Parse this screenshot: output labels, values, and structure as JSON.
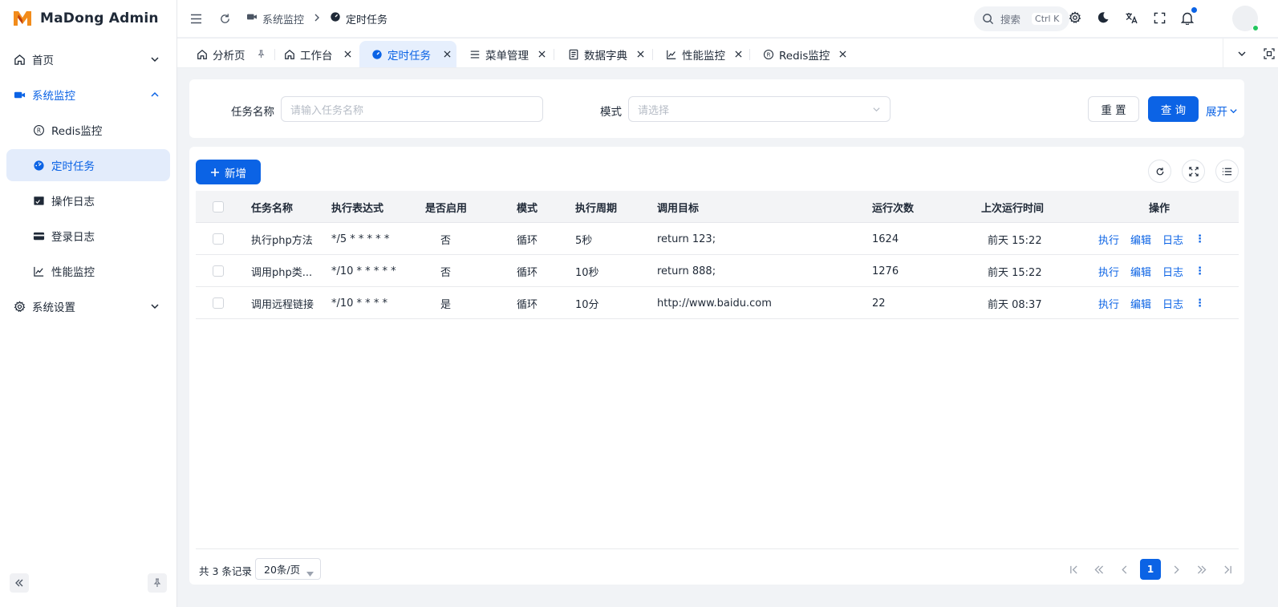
{
  "app": {
    "title": "MaDong Admin",
    "logo_letter": "M"
  },
  "sidebar": {
    "items": [
      {
        "label": "首页",
        "icon": "home-icon"
      },
      {
        "label": "系统监控",
        "icon": "monitor-icon"
      },
      {
        "label": "Redis监控",
        "icon": "redis-icon"
      },
      {
        "label": "定时任务",
        "icon": "dashboard-icon"
      },
      {
        "label": "操作日志",
        "icon": "log-icon"
      },
      {
        "label": "登录日志",
        "icon": "card-icon"
      },
      {
        "label": "性能监控",
        "icon": "chart-line-icon"
      },
      {
        "label": "系统设置",
        "icon": "gear-icon"
      }
    ]
  },
  "header": {
    "breadcrumb": [
      "系统监控",
      "定时任务"
    ],
    "search_placeholder": "搜索",
    "search_shortcut": "Ctrl K"
  },
  "tabs": [
    {
      "label": "分析页",
      "active": false
    },
    {
      "label": "工作台",
      "active": false
    },
    {
      "label": "定时任务",
      "active": true
    },
    {
      "label": "菜单管理",
      "active": false
    },
    {
      "label": "数据字典",
      "active": false
    },
    {
      "label": "性能监控",
      "active": false
    },
    {
      "label": "Redis监控",
      "active": false
    }
  ],
  "filter": {
    "task_name_label": "任务名称",
    "task_name_placeholder": "请输入任务名称",
    "mode_label": "模式",
    "mode_placeholder": "请选择",
    "reset_label": "重 置",
    "query_label": "查 询",
    "expand_label": "展开"
  },
  "table": {
    "add_label": "新增",
    "columns": [
      "任务名称",
      "执行表达式",
      "是否启用",
      "模式",
      "执行周期",
      "调用目标",
      "运行次数",
      "上次运行时间",
      "操作"
    ],
    "rows": [
      {
        "name": "执行php方法",
        "expr": "*/5 * * * * *",
        "enabled": "否",
        "mode": "循环",
        "period": "5秒",
        "target": "return 123;",
        "runs": "1624",
        "last": "前天 15:22"
      },
      {
        "name": "调用php类...",
        "expr": "*/10 * * * * *",
        "enabled": "否",
        "mode": "循环",
        "period": "10秒",
        "target": "return 888;",
        "runs": "1276",
        "last": "前天 15:22"
      },
      {
        "name": "调用远程链接",
        "expr": "*/10 * * * *",
        "enabled": "是",
        "mode": "循环",
        "period": "10分",
        "target": "http://www.baidu.com",
        "runs": "22",
        "last": "前天 08:37"
      }
    ],
    "actions": {
      "run": "执行",
      "edit": "编辑",
      "log": "日志"
    }
  },
  "footer": {
    "total": "共 3 条记录",
    "page_size": "20条/页",
    "current_page": "1"
  },
  "colors": {
    "primary": "#0b63e5",
    "logo_orange": "#f28c1b"
  }
}
